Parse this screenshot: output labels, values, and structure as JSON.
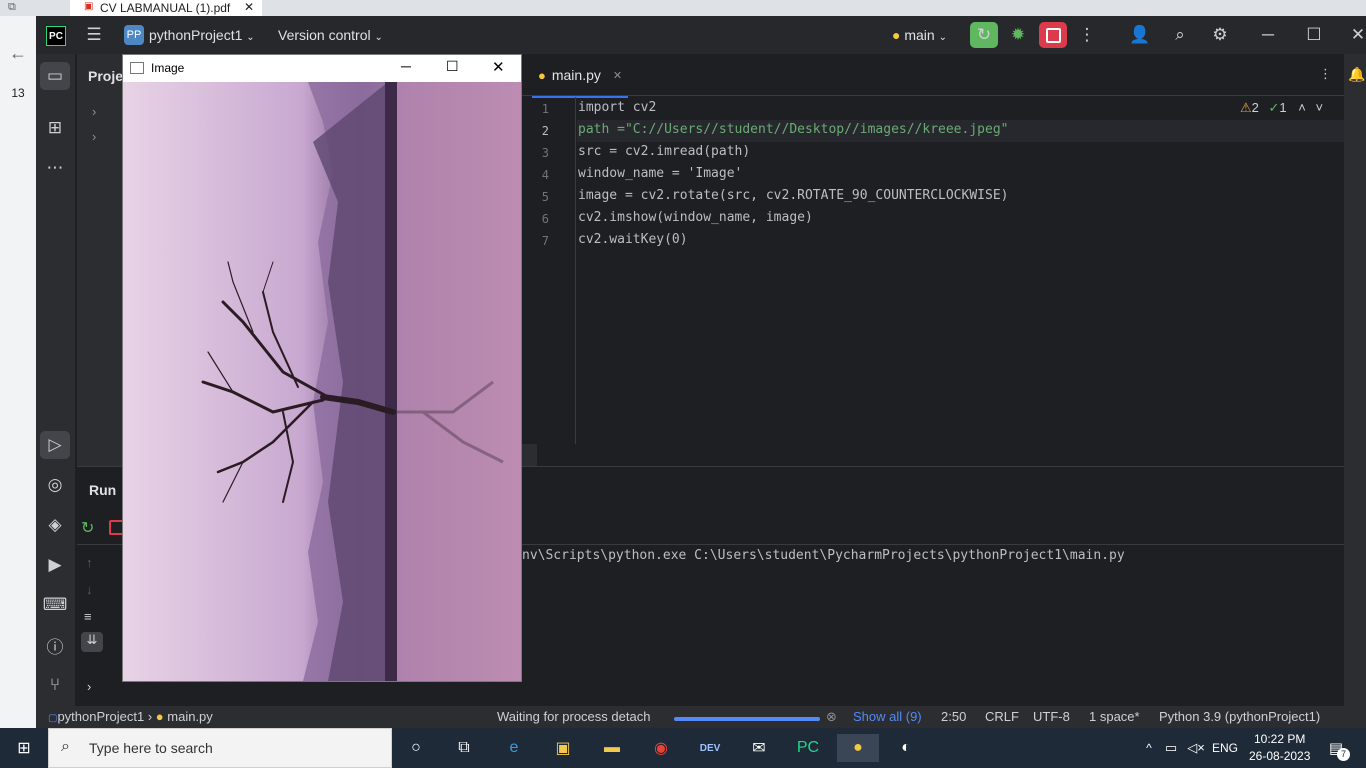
{
  "browser": {
    "tab_title": "CV LABMANUAL (1).pdf",
    "side_number": "13"
  },
  "ide": {
    "logo": "PC",
    "project_badge": "PP",
    "project_name": "pythonProject1",
    "vcs_label": "Version control",
    "branch": "main",
    "project_panel_title": "Proje",
    "editor_tab": "main.py",
    "inspection_warnings": "2",
    "inspection_ok": "1",
    "code_lines": [
      {
        "num": "1",
        "text": "import cv2"
      },
      {
        "num": "2",
        "text": "path =\"C://Users//student//Desktop//images//kreee.jpeg\""
      },
      {
        "num": "3",
        "text": "src = cv2.imread(path)"
      },
      {
        "num": "4",
        "text": "window_name = 'Image'"
      },
      {
        "num": "5",
        "text": "image = cv2.rotate(src, cv2.ROTATE_90_COUNTERCLOCKWISE)"
      },
      {
        "num": "6",
        "text": "cv2.imshow(window_name, image)"
      },
      {
        "num": "7",
        "text": "cv2.waitKey(0)"
      }
    ],
    "run_tab": "Run",
    "run_output": "nv\\Scripts\\python.exe C:\\Users\\student\\PycharmProjects\\pythonProject1\\main.py"
  },
  "image_window": {
    "title": "Image"
  },
  "status_bar": {
    "breadcrumb_project": "pythonProject1",
    "breadcrumb_file": "main.py",
    "process_text": "Waiting for process detach",
    "show_all": "Show all (9)",
    "position": "2:50",
    "line_sep": "CRLF",
    "encoding": "UTF-8",
    "indent": "1 space*",
    "interpreter": "Python 3.9 (pythonProject1)"
  },
  "taskbar": {
    "search_placeholder": "Type here to search",
    "language": "ENG",
    "time": "10:22 PM",
    "date": "26-08-2023",
    "notification_count": "7"
  },
  "colors": {
    "accent_green": "#5fb85f",
    "stop_red": "#db3b4b",
    "link_blue": "#548af7"
  }
}
